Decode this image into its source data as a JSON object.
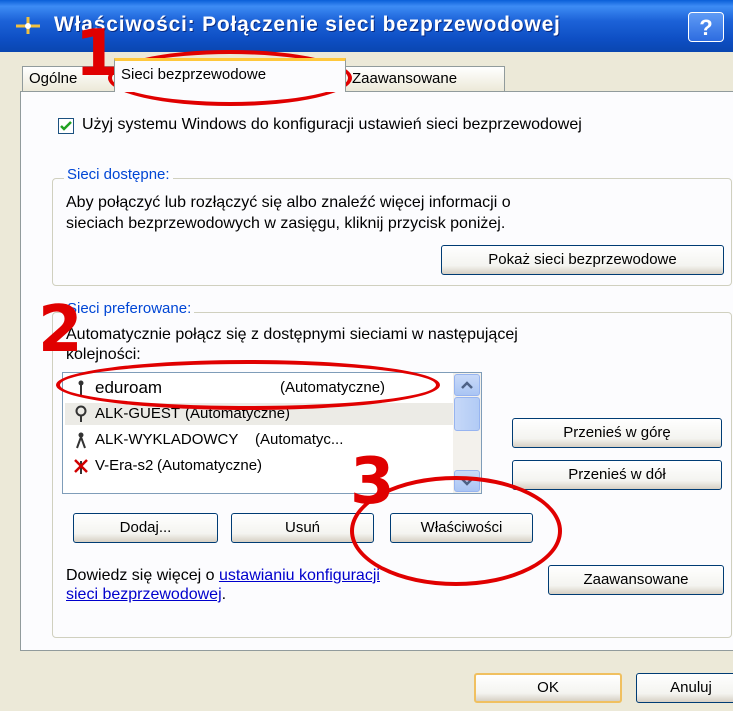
{
  "window": {
    "title": "Właściwości: Połączenie sieci bezprzewodowej",
    "help_label": "?"
  },
  "tabs": [
    {
      "label": "Ogólne",
      "active": false
    },
    {
      "label": "Sieci bezprzewodowe",
      "active": true
    },
    {
      "label": "Zaawansowane",
      "active": false
    }
  ],
  "use_windows_checkbox": {
    "label": "Użyj systemu Windows do konfiguracji ustawień sieci bezprzewodowej",
    "checked": true
  },
  "available_networks": {
    "legend": "Sieci dostępne:",
    "line1": "Aby połączyć lub rozłączyć się albo znaleźć więcej informacji o",
    "line2": "sieciach bezprzewodowych w zasięgu, kliknij przycisk poniżej.",
    "show_button": "Pokaż sieci bezprzewodowe"
  },
  "preferred_networks": {
    "legend": "Sieci preferowane:",
    "line1": "Automatycznie połącz się z dostępnymi sieciami w następującej",
    "line2": "kolejności:",
    "list": [
      {
        "name": "eduroam",
        "status": "(Automatyczne)",
        "icon": "antenna-icon"
      },
      {
        "name": "ALK-GUEST",
        "status": "(Automatyczne)",
        "icon": "network-key-icon"
      },
      {
        "name": "ALK-WYKLADOWCY",
        "status": "(Automatyc...",
        "icon": "antenna-icon"
      },
      {
        "name": "V-Era-s2",
        "status": "(Automatyczne)",
        "icon": "network-error-icon"
      }
    ],
    "move_up": "Przenieś w górę",
    "move_down": "Przenieś w dół",
    "add": "Dodaj...",
    "remove": "Usuń",
    "properties": "Właściwości"
  },
  "learn_more": {
    "prefix": "Dowiedz się więcej o ",
    "link_part1": "ustawianiu konfiguracji",
    "link_part2": "sieci bezprzewodowej",
    "suffix": "."
  },
  "advanced_button": "Zaawansowane",
  "footer": {
    "ok": "OK",
    "cancel": "Anuluj"
  },
  "annotations": {
    "marker1": "1",
    "marker2": "2",
    "marker3": "3",
    "color": "#e00000"
  }
}
